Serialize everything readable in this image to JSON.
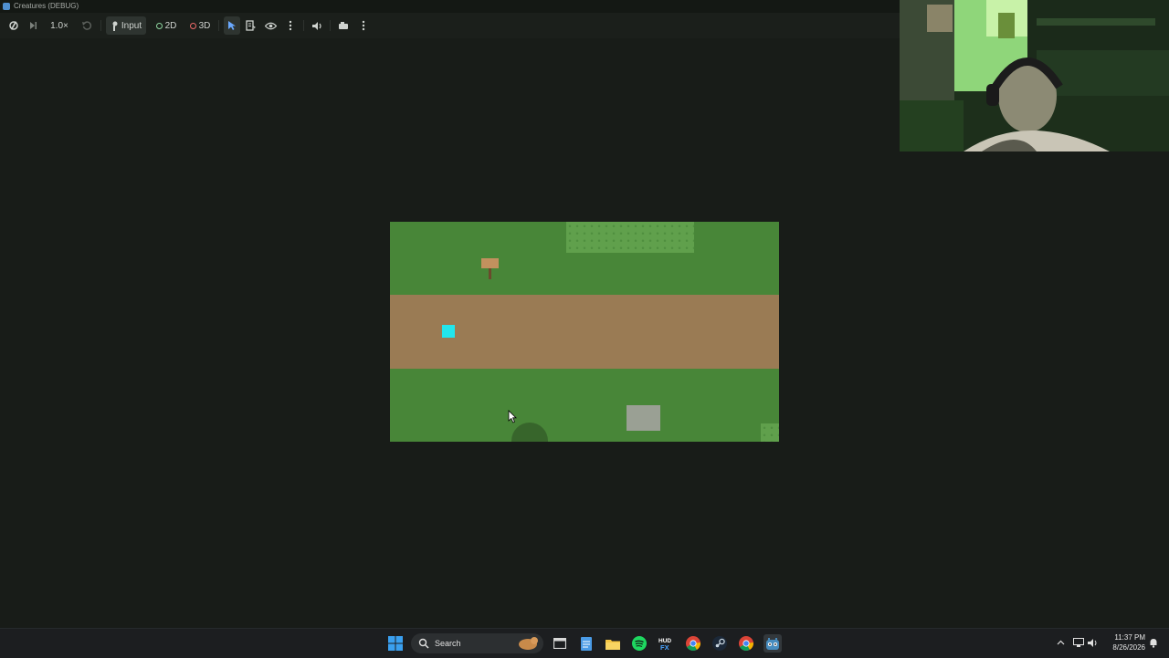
{
  "window": {
    "title": "Creatures (DEBUG)"
  },
  "toolbar": {
    "speed_label": "1.0×",
    "input_label": "Input",
    "mode_2d_label": "2D",
    "mode_3d_label": "3D"
  },
  "taskbar": {
    "search_label": "Search",
    "time": "11:37 PM",
    "date": "8/26/2026"
  },
  "colors": {
    "grass": "#488638",
    "tall_grass": "#60a04c",
    "dirt_path": "#9a7b54",
    "player": "#22e6ec",
    "rock": "#9aa094",
    "sign": "#c2915e",
    "bush": "#37652b",
    "background": "#181c18"
  }
}
